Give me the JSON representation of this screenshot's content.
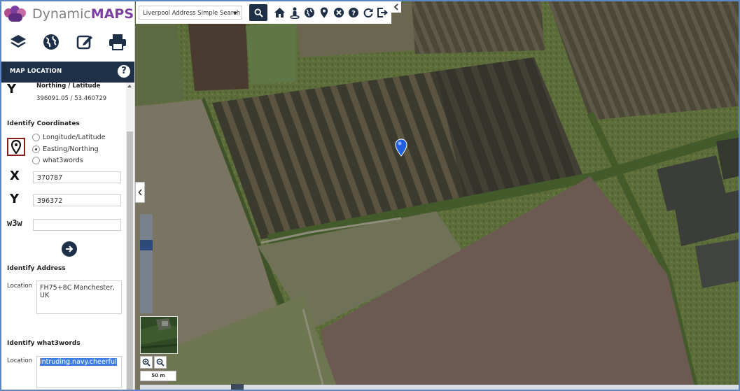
{
  "app": {
    "brand_prefix": "Dynamic",
    "brand_suffix": "MAPS",
    "brand_color": "#7b3fa0",
    "nav_color": "#1d3048"
  },
  "toolbar": {
    "icons": [
      "layers-icon",
      "globe-icon",
      "edit-icon",
      "print-icon"
    ]
  },
  "panel": {
    "title": "MAP LOCATION",
    "help": "?",
    "current": {
      "axis_label": "Y",
      "heading": "Northing / Latitude",
      "value": "396091.05 / 53.460729"
    },
    "identify_coordinates": {
      "heading": "Identify Coordinates",
      "options": [
        "Longitude/Latitude",
        "Easting/Northing",
        "what3words"
      ],
      "selected": "Easting/Northing",
      "x_label": "X",
      "x_value": "370787",
      "y_label": "Y",
      "y_value": "396372",
      "w3w_label": "w3w",
      "w3w_value": ""
    },
    "identify_address": {
      "heading": "Identify Address",
      "location_label": "Location",
      "location_value": "FH75+8C Manchester, UK"
    },
    "identify_w3w": {
      "heading": "Identify what3words",
      "location_label": "Location",
      "location_value": "intruding.navy.cheerful"
    }
  },
  "search": {
    "selected": "Liverpool Address Simple Search"
  },
  "top_icons": [
    "home-icon",
    "street-view-icon",
    "globe-icon",
    "location-pin-icon",
    "clear-icon",
    "help-icon",
    "refresh-icon",
    "logout-icon"
  ],
  "map": {
    "scale_label": "50 m",
    "zoom_level_fraction": 0.26
  }
}
